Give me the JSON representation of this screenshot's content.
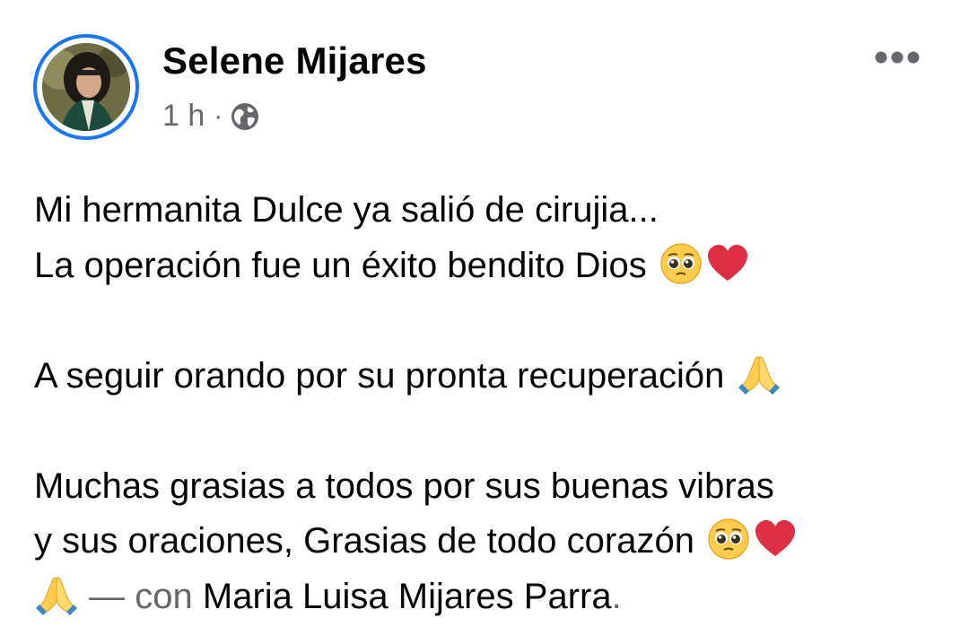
{
  "post": {
    "author": "Selene Mijares",
    "timestamp": "1 h",
    "separator": "·",
    "privacy_icon": "globe-icon",
    "more_icon": "more-horizontal-icon",
    "body": {
      "line1": "Mi hermanita Dulce ya salió de cirujia...",
      "line2": "La operación fue un éxito bendito Dios",
      "line3": "A seguir orando por su pronta recuperación",
      "line4": "Muchas grasias a todos por sus buenas vibras",
      "line5": "y sus oraciones, Grasias de todo corazón",
      "with_dash": "—",
      "with_word": "con",
      "tagged_person": "Maria Luisa Mijares Parra",
      "end_period": "."
    },
    "emoji_icons": [
      "pleading-face-icon",
      "red-heart-icon",
      "folded-hands-icon"
    ],
    "colors": {
      "avatar_ring": "#1877f2",
      "text_primary": "#050505",
      "text_secondary": "#65676b"
    }
  }
}
